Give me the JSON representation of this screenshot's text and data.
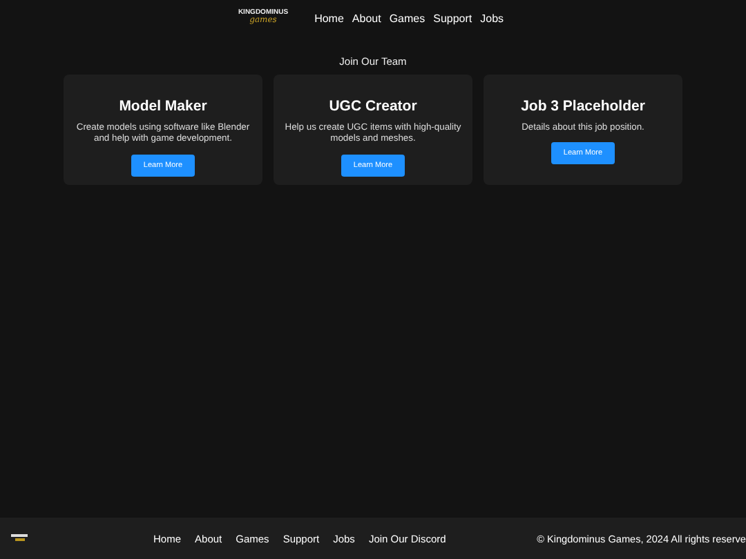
{
  "header": {
    "logo": {
      "top": "KINGDOMINUS",
      "script": "games"
    },
    "nav": [
      "Home",
      "About",
      "Games",
      "Support",
      "Jobs"
    ]
  },
  "section": {
    "title": "Join Our Team",
    "jobs": [
      {
        "title": "Model Maker",
        "description": "Create models using software like Blender and help with game development.",
        "button": "Learn More"
      },
      {
        "title": "UGC Creator",
        "description": "Help us create UGC items with high-quality models and meshes.",
        "button": "Learn More"
      },
      {
        "title": "Job 3 Placeholder",
        "description": "Details about this job position.",
        "button": "Learn More"
      }
    ]
  },
  "footer": {
    "nav": [
      "Home",
      "About",
      "Games",
      "Support",
      "Jobs",
      "Join Our Discord"
    ],
    "copyright": "© Kingdominus Games, 2024 All rights reserve"
  }
}
